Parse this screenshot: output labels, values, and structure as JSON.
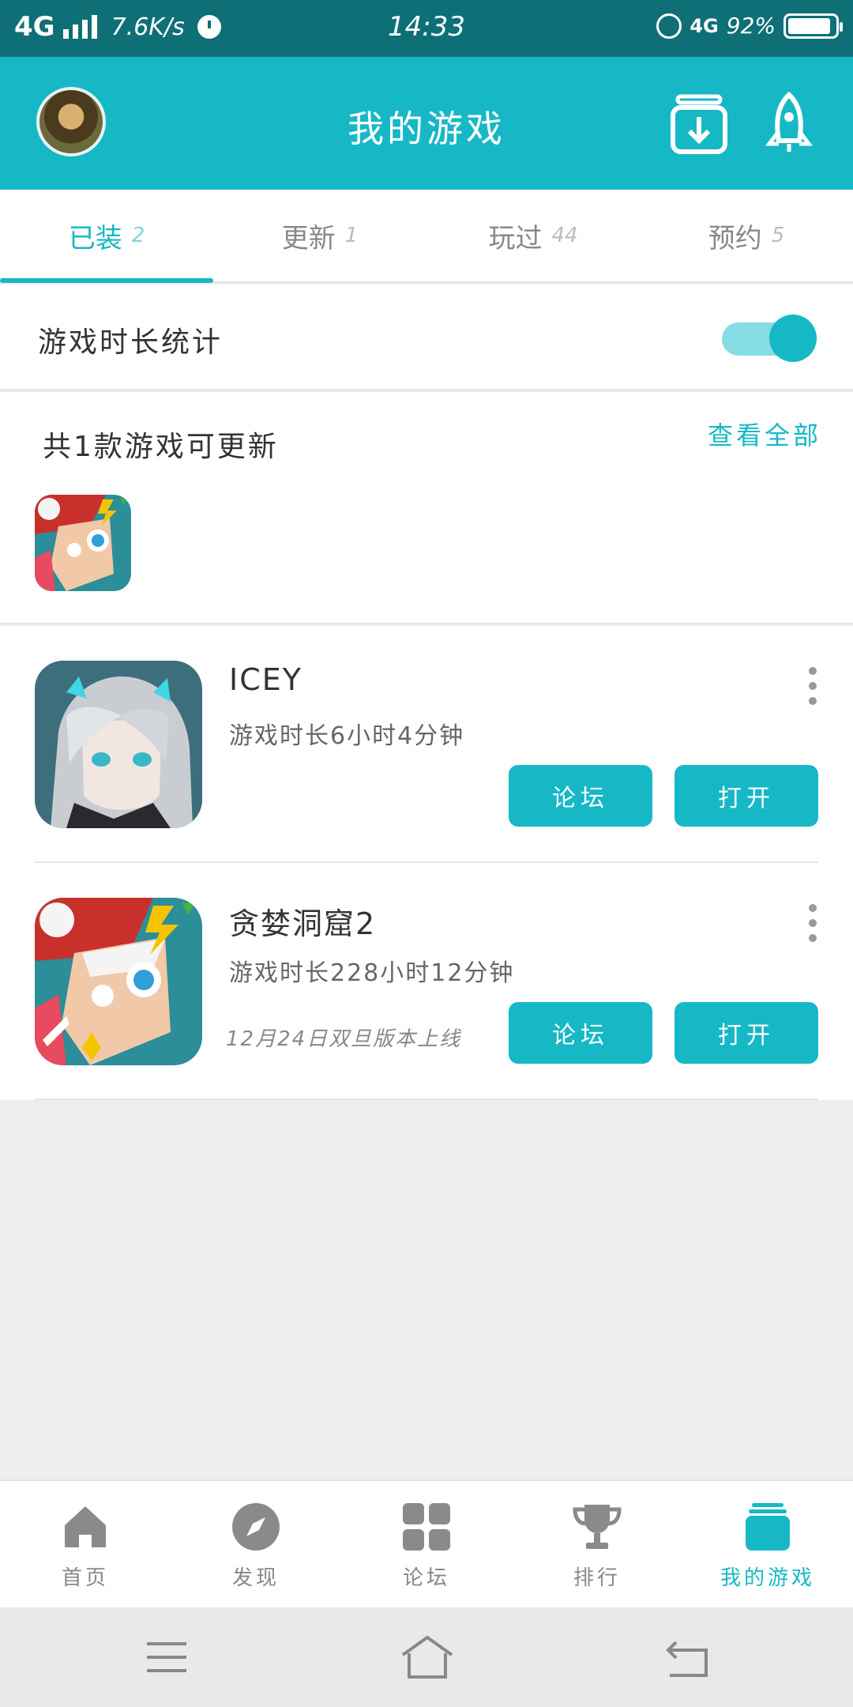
{
  "status_bar": {
    "network": "4G",
    "speed": "7.6K/s",
    "time": "14:33",
    "network_right": "4G",
    "battery": "92%",
    "battery_level": 0.92,
    "alarm_icon": "alarm-clock-icon"
  },
  "header": {
    "title": "我的游戏",
    "avatar": "user-avatar",
    "download_icon": "download-manager-icon",
    "rocket_icon": "rocket-boost-icon",
    "color": "#16b8c6"
  },
  "tabs": [
    {
      "label": "已装",
      "count": "2",
      "active": true
    },
    {
      "label": "更新",
      "count": "1",
      "active": false
    },
    {
      "label": "玩过",
      "count": "44",
      "active": false
    },
    {
      "label": "预约",
      "count": "5",
      "active": false
    }
  ],
  "stats": {
    "label": "游戏时长统计",
    "toggle_on": true
  },
  "updates": {
    "title": "共1款游戏可更新",
    "view_all": "查看全部"
  },
  "games": [
    {
      "name": "ICEY",
      "playtime": "游戏时长6小时4分钟",
      "note": "",
      "forum_label": "论坛",
      "open_label": "打开"
    },
    {
      "name": "贪婪洞窟2",
      "playtime": "游戏时长228小时12分钟",
      "note": "12月24日双旦版本上线",
      "forum_label": "论坛",
      "open_label": "打开"
    }
  ],
  "bottom_nav": [
    {
      "label": "首页",
      "icon": "home-icon",
      "active": false
    },
    {
      "label": "发现",
      "icon": "compass-icon",
      "active": false
    },
    {
      "label": "论坛",
      "icon": "grid-icon",
      "active": false
    },
    {
      "label": "排行",
      "icon": "trophy-icon",
      "active": false
    },
    {
      "label": "我的游戏",
      "icon": "my-games-stack-icon",
      "active": true
    }
  ],
  "colors": {
    "accent": "#16b8c6",
    "status_bar": "#0f6f77",
    "nav_inactive": "#888888"
  }
}
